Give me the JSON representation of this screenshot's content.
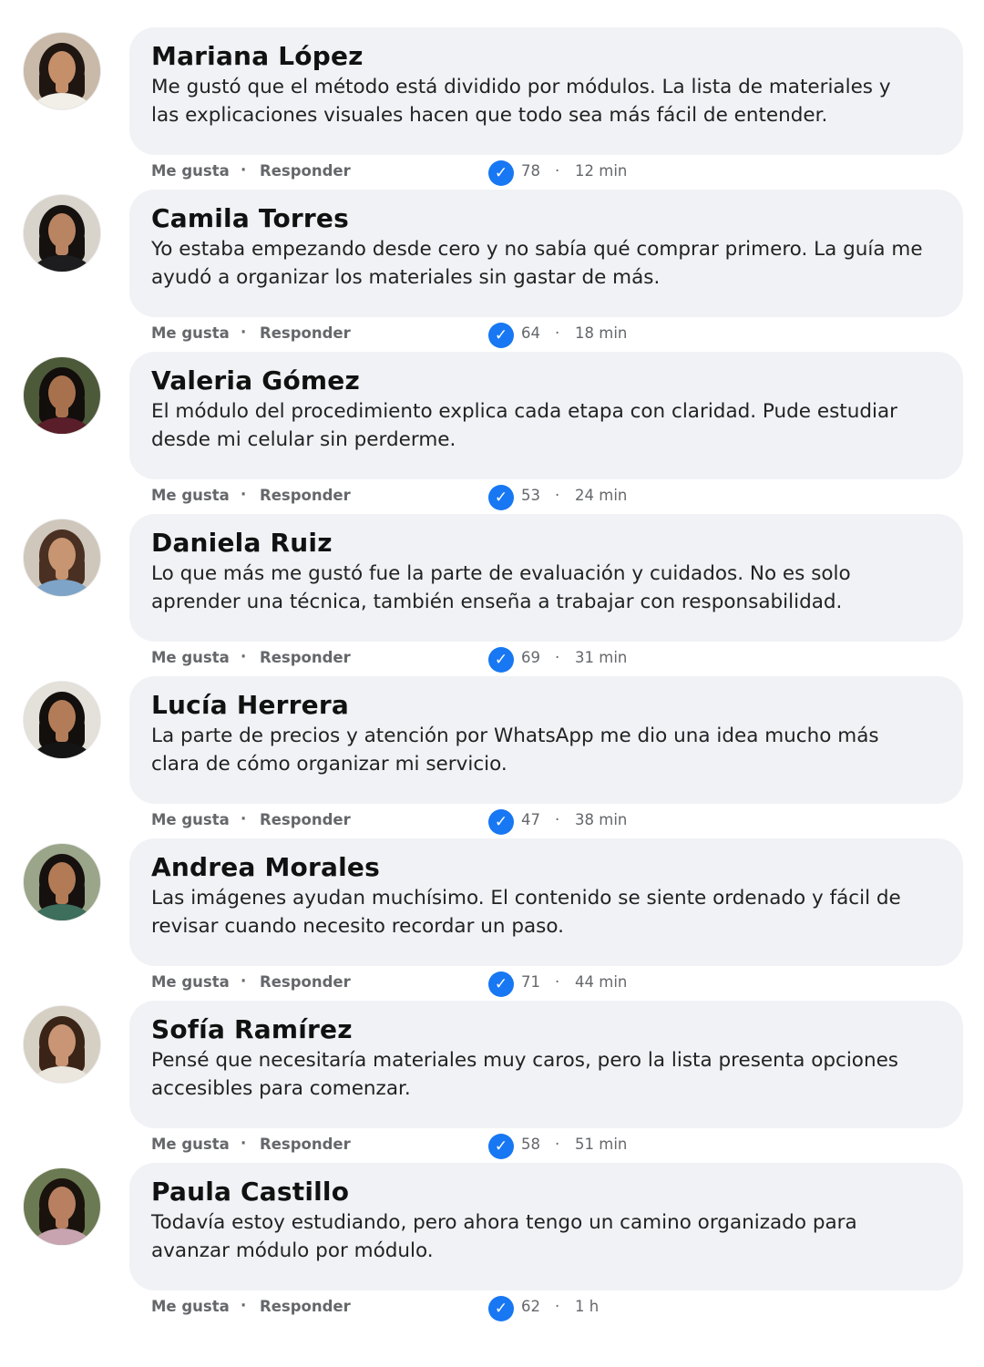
{
  "actions": {
    "like_label": "Me gusta",
    "reply_label": "Responder",
    "separator": "·"
  },
  "colors": {
    "bubble": "#f0f2f5",
    "verified_badge": "#1877f2",
    "meta_text": "#65676b"
  },
  "comments": [
    {
      "author": "Mariana López",
      "text": "Me gustó que el método está dividido por módulos. La lista de materiales y\nlas explicaciones visuales hacen que todo sea más fácil de entender.",
      "reactions": "78",
      "time": "12 min",
      "avatar": {
        "bg": "#c9b9a8",
        "hair": "#1f1612",
        "skin": "#c58f6a",
        "shirt": "#f2efe9"
      }
    },
    {
      "author": "Camila Torres",
      "text": "Yo estaba empezando desde cero y no sabía qué comprar primero. La guía me\nayudó a organizar los materiales sin gastar de más.",
      "reactions": "64",
      "time": "18 min",
      "avatar": {
        "bg": "#d8d4cc",
        "hair": "#15110f",
        "skin": "#b98462",
        "shirt": "#1d1d1f"
      }
    },
    {
      "author": "Valeria Gómez",
      "text": "El módulo del procedimiento explica cada etapa con claridad. Pude estudiar\ndesde mi celular sin perderme.",
      "reactions": "53",
      "time": "24 min",
      "avatar": {
        "bg": "#4d5a3a",
        "hair": "#120e0c",
        "skin": "#a8714e",
        "shirt": "#5a1e2a"
      }
    },
    {
      "author": "Daniela Ruiz",
      "text": "Lo que más me gustó fue la parte de evaluación y cuidados. No es solo\naprender una técnica, también enseña a trabajar con responsabilidad.",
      "reactions": "69",
      "time": "31 min",
      "avatar": {
        "bg": "#cfc7bb",
        "hair": "#4a3022",
        "skin": "#c79572",
        "shirt": "#7ea4c8"
      }
    },
    {
      "author": "Lucía Herrera",
      "text": "La parte de precios y atención por WhatsApp me dio una idea mucho más\nclara de cómo organizar mi servicio.",
      "reactions": "47",
      "time": "38 min",
      "avatar": {
        "bg": "#e4e0da",
        "hair": "#120f0d",
        "skin": "#b37c58",
        "shirt": "#141414"
      }
    },
    {
      "author": "Andrea Morales",
      "text": "Las imágenes ayudan muchísimo. El contenido se siente ordenado y fácil de\nrevisar cuando necesito recordar un paso.",
      "reactions": "71",
      "time": "44 min",
      "avatar": {
        "bg": "#9aa58a",
        "hair": "#16110e",
        "skin": "#b27a55",
        "shirt": "#3e6e5c"
      }
    },
    {
      "author": "Sofía Ramírez",
      "text": "Pensé que necesitaría materiales muy caros, pero la lista presenta opciones\naccesibles para comenzar.",
      "reactions": "58",
      "time": "51 min",
      "avatar": {
        "bg": "#d6cfc4",
        "hair": "#3a2418",
        "skin": "#c99574",
        "shirt": "#ebe6de"
      }
    },
    {
      "author": "Paula Castillo",
      "text": "Todavía estoy estudiando, pero ahora tengo un camino organizado para\navanzar módulo por módulo.",
      "reactions": "62",
      "time": "1 h",
      "avatar": {
        "bg": "#6b7a52",
        "hair": "#1a120d",
        "skin": "#b88060",
        "shirt": "#c7a4b0"
      }
    }
  ]
}
